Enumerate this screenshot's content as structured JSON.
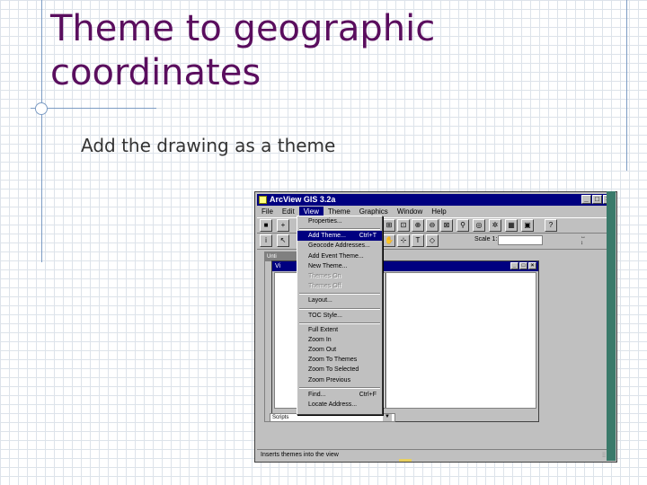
{
  "slide": {
    "title_line1": "Theme to geographic",
    "title_line2": "coordinates",
    "bullet": "Add the drawing as a theme"
  },
  "app": {
    "title": "ArcView GIS 3.2a",
    "menus": [
      "File",
      "Edit",
      "View",
      "Theme",
      "Graphics",
      "Window",
      "Help"
    ],
    "active_menu_index": 2,
    "scale_label": "Scale 1:",
    "scale_value": "",
    "project_title": "Unti",
    "view_title": "Vi",
    "scripts_label": "Scripts",
    "status_text": "Inserts themes into the view"
  },
  "view_menu": {
    "items": [
      {
        "label": "Properties...",
        "shortcut": "",
        "state": "normal"
      },
      {
        "type": "separator"
      },
      {
        "label": "Add Theme...",
        "shortcut": "Ctrl+T",
        "state": "highlighted"
      },
      {
        "label": "Geocode Addresses...",
        "shortcut": "",
        "state": "normal"
      },
      {
        "label": "Add Event Theme...",
        "shortcut": "",
        "state": "normal"
      },
      {
        "label": "New Theme...",
        "shortcut": "",
        "state": "normal"
      },
      {
        "label": "Themes On",
        "shortcut": "",
        "state": "disabled"
      },
      {
        "label": "Themes Off",
        "shortcut": "",
        "state": "disabled"
      },
      {
        "type": "separator"
      },
      {
        "label": "Layout...",
        "shortcut": "",
        "state": "normal"
      },
      {
        "type": "separator"
      },
      {
        "label": "TOC Style...",
        "shortcut": "",
        "state": "normal"
      },
      {
        "type": "separator"
      },
      {
        "label": "Full Extent",
        "shortcut": "",
        "state": "normal"
      },
      {
        "label": "Zoom In",
        "shortcut": "",
        "state": "normal"
      },
      {
        "label": "Zoom Out",
        "shortcut": "",
        "state": "normal"
      },
      {
        "label": "Zoom To Themes",
        "shortcut": "",
        "state": "normal"
      },
      {
        "label": "Zoom To Selected",
        "shortcut": "",
        "state": "normal"
      },
      {
        "label": "Zoom Previous",
        "shortcut": "",
        "state": "normal"
      },
      {
        "type": "separator"
      },
      {
        "label": "Find...",
        "shortcut": "Ctrl+F",
        "state": "normal"
      },
      {
        "label": "Locate Address...",
        "shortcut": "",
        "state": "normal"
      }
    ]
  }
}
